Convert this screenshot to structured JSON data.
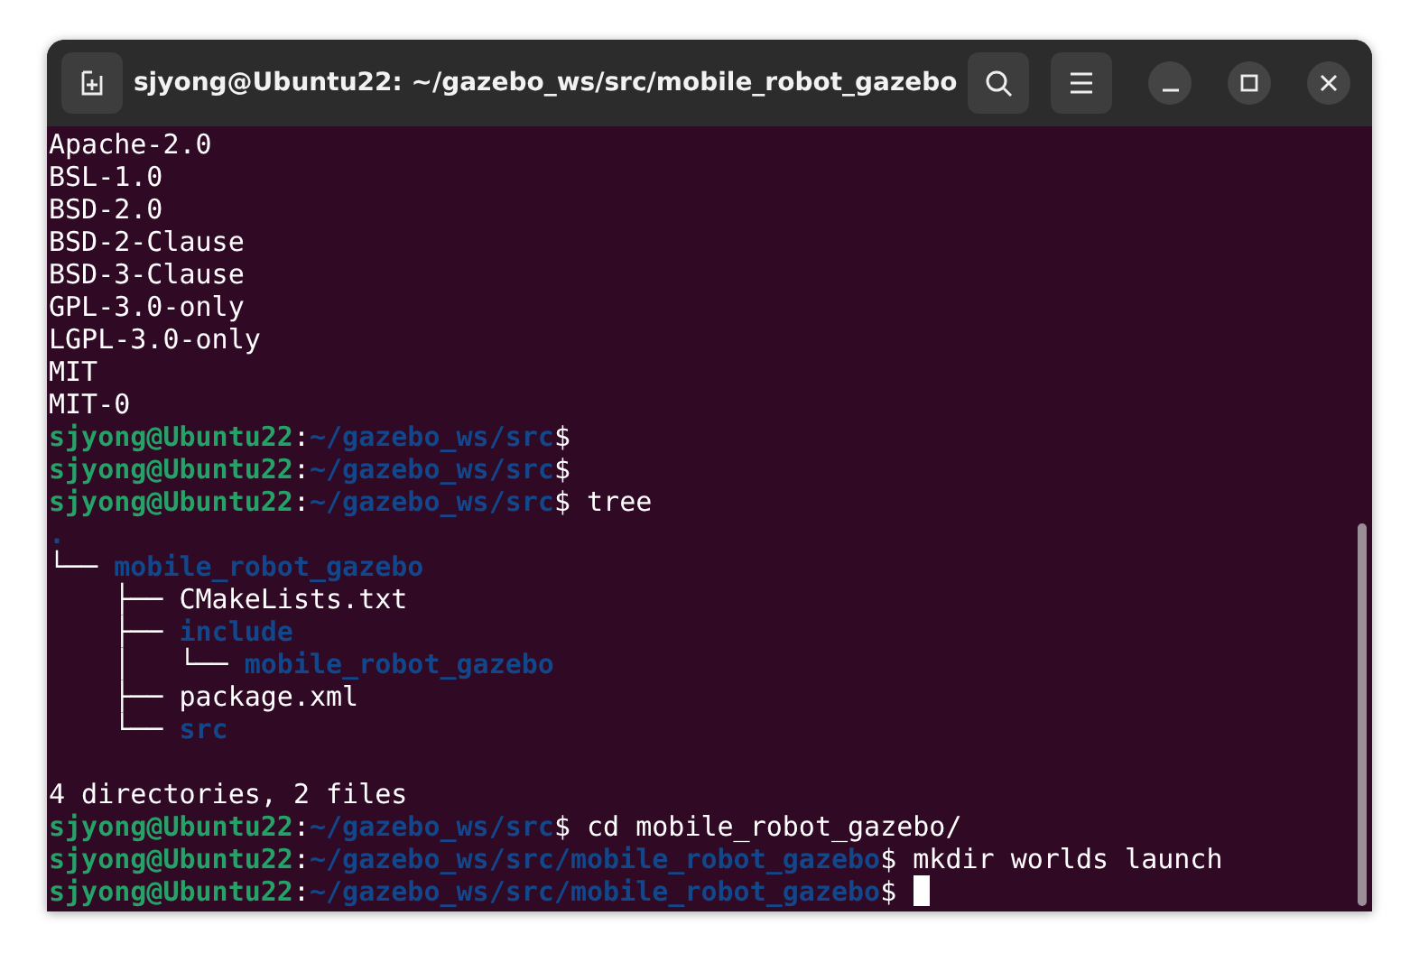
{
  "window": {
    "title": "sjyong@Ubuntu22: ~/gazebo_ws/src/mobile_robot_gazebo"
  },
  "terminal": {
    "lines": [
      [
        {
          "kind": "plain",
          "text": "Apache-2.0"
        }
      ],
      [
        {
          "kind": "plain",
          "text": "BSL-1.0"
        }
      ],
      [
        {
          "kind": "plain",
          "text": "BSD-2.0"
        }
      ],
      [
        {
          "kind": "plain",
          "text": "BSD-2-Clause"
        }
      ],
      [
        {
          "kind": "plain",
          "text": "BSD-3-Clause"
        }
      ],
      [
        {
          "kind": "plain",
          "text": "GPL-3.0-only"
        }
      ],
      [
        {
          "kind": "plain",
          "text": "LGPL-3.0-only"
        }
      ],
      [
        {
          "kind": "plain",
          "text": "MIT"
        }
      ],
      [
        {
          "kind": "plain",
          "text": "MIT-0"
        }
      ],
      [
        {
          "kind": "user",
          "text": "sjyong@Ubuntu22"
        },
        {
          "kind": "plain",
          "text": ":"
        },
        {
          "kind": "path",
          "text": "~/gazebo_ws/src"
        },
        {
          "kind": "plain",
          "text": "$"
        }
      ],
      [
        {
          "kind": "user",
          "text": "sjyong@Ubuntu22"
        },
        {
          "kind": "plain",
          "text": ":"
        },
        {
          "kind": "path",
          "text": "~/gazebo_ws/src"
        },
        {
          "kind": "plain",
          "text": "$"
        }
      ],
      [
        {
          "kind": "user",
          "text": "sjyong@Ubuntu22"
        },
        {
          "kind": "plain",
          "text": ":"
        },
        {
          "kind": "path",
          "text": "~/gazebo_ws/src"
        },
        {
          "kind": "plain",
          "text": "$ tree"
        }
      ],
      [
        {
          "kind": "dir",
          "text": "."
        }
      ],
      [
        {
          "kind": "plain",
          "text": "└── "
        },
        {
          "kind": "dir",
          "text": "mobile_robot_gazebo"
        }
      ],
      [
        {
          "kind": "plain",
          "text": "    ├── CMakeLists.txt"
        }
      ],
      [
        {
          "kind": "plain",
          "text": "    ├── "
        },
        {
          "kind": "dir",
          "text": "include"
        }
      ],
      [
        {
          "kind": "plain",
          "text": "    │   └── "
        },
        {
          "kind": "dir",
          "text": "mobile_robot_gazebo"
        }
      ],
      [
        {
          "kind": "plain",
          "text": "    ├── package.xml"
        }
      ],
      [
        {
          "kind": "plain",
          "text": "    └── "
        },
        {
          "kind": "dir",
          "text": "src"
        }
      ],
      {
        "kind": "blank"
      },
      [
        {
          "kind": "plain",
          "text": "4 directories, 2 files"
        }
      ],
      [
        {
          "kind": "user",
          "text": "sjyong@Ubuntu22"
        },
        {
          "kind": "plain",
          "text": ":"
        },
        {
          "kind": "path",
          "text": "~/gazebo_ws/src"
        },
        {
          "kind": "plain",
          "text": "$ cd mobile_robot_gazebo/"
        }
      ],
      [
        {
          "kind": "user",
          "text": "sjyong@Ubuntu22"
        },
        {
          "kind": "plain",
          "text": ":"
        },
        {
          "kind": "path",
          "text": "~/gazebo_ws/src/mobile_robot_gazebo"
        },
        {
          "kind": "plain",
          "text": "$ mkdir worlds launch"
        }
      ],
      [
        {
          "kind": "user",
          "text": "sjyong@Ubuntu22"
        },
        {
          "kind": "plain",
          "text": ":"
        },
        {
          "kind": "path",
          "text": "~/gazebo_ws/src/mobile_robot_gazebo"
        },
        {
          "kind": "plain",
          "text": "$ "
        },
        {
          "kind": "cursor"
        }
      ]
    ]
  }
}
